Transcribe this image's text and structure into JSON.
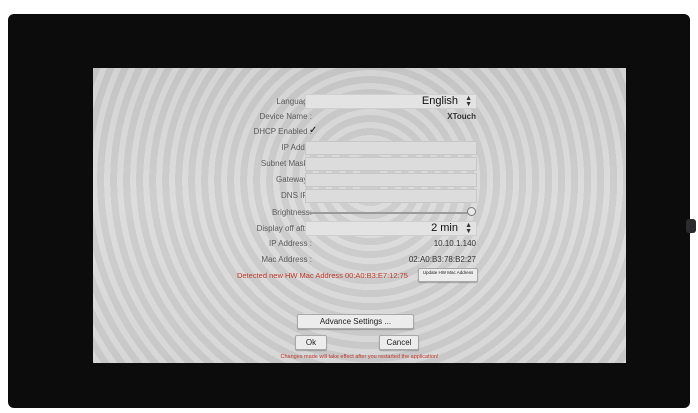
{
  "form": {
    "language": {
      "label": "Language",
      "value": "English"
    },
    "device_name": {
      "label": "Device Name :",
      "value": "XTouch"
    },
    "dhcp": {
      "label": "DHCP Enabled :",
      "checked": "✓"
    },
    "ip_addr": {
      "label": "IP Addr :",
      "value": ""
    },
    "subnet_mask": {
      "label": "Subnet Mask :",
      "value": ""
    },
    "gateway": {
      "label": "Gateway :",
      "value": ""
    },
    "dns_ip": {
      "label": "DNS IP :",
      "value": ""
    },
    "brightness": {
      "label": "Brightness:",
      "level": 1.0
    },
    "display_off": {
      "label": "Display off after",
      "value": "2 min"
    },
    "ip_address": {
      "label": "IP Address :",
      "value": "10.10.1.140"
    },
    "mac_address": {
      "label": "Mac Address :",
      "value": "02:A0:B3:78:B2:27"
    }
  },
  "warning": "Detected new HW Mac Address 00:A0:B3:E7:12:75",
  "buttons": {
    "update_mac": "Update HW Mac Address",
    "advance": "Advance Settings ...",
    "ok": "Ok",
    "cancel": "Cancel"
  },
  "note": "Changes made will take effect after you restarted the application!",
  "icons": {
    "dropdown": "updown-arrow-icon",
    "check": "checkmark-icon",
    "slider": "slider-knob"
  }
}
